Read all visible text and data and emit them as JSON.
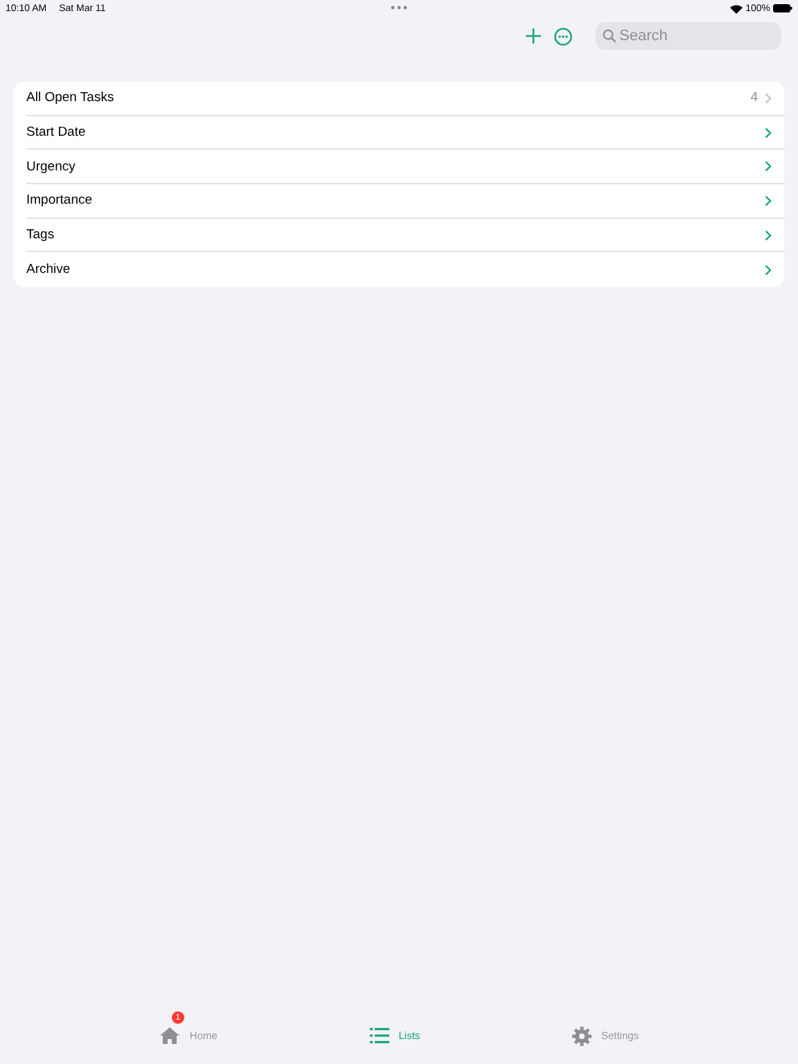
{
  "status_bar": {
    "time": "10:10 AM",
    "date": "Sat Mar 11",
    "battery": "100%"
  },
  "toolbar": {
    "search": {
      "placeholder": "Search"
    }
  },
  "rows": [
    {
      "label": "All Open Tasks",
      "kind": "count",
      "count": "4"
    },
    {
      "label": "Start Date",
      "kind": "link"
    },
    {
      "label": "Urgency",
      "kind": "link"
    },
    {
      "label": "Importance",
      "kind": "link"
    },
    {
      "label": "Tags",
      "kind": "link"
    },
    {
      "label": "Archive",
      "kind": "link"
    }
  ],
  "tabs": [
    {
      "label": "Home",
      "kind": "home",
      "badge": "1",
      "selected": false
    },
    {
      "label": "Lists",
      "kind": "lists",
      "selected": true
    },
    {
      "label": "Settings",
      "kind": "settings",
      "selected": false
    }
  ]
}
